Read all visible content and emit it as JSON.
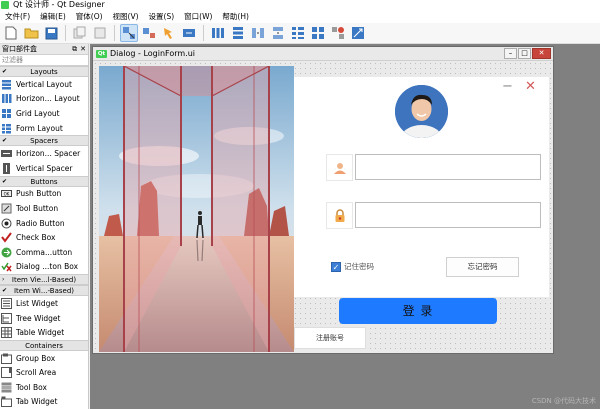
{
  "window": {
    "title": "Qt 设计师 - Qt Designer"
  },
  "menubar": [
    {
      "label": "文件(F)"
    },
    {
      "label": "编辑(E)"
    },
    {
      "label": "窗体(O)"
    },
    {
      "label": "视图(V)"
    },
    {
      "label": "设置(S)"
    },
    {
      "label": "窗口(W)"
    },
    {
      "label": "帮助(H)"
    }
  ],
  "widgetbox": {
    "title": "窗口部件盒",
    "filter_placeholder": "过滤器",
    "sections": [
      {
        "name": "Layouts",
        "items": [
          "Vertical Layout",
          "Horizon... Layout",
          "Grid Layout",
          "Form Layout"
        ]
      },
      {
        "name": "Spacers",
        "items": [
          "Horizon... Spacer",
          "Vertical Spacer"
        ]
      },
      {
        "name": "Buttons",
        "items": [
          "Push Button",
          "Tool Button",
          "Radio Button",
          "Check Box",
          "Comma...utton",
          "Dialog ...ton Box"
        ]
      },
      {
        "name": "Item Vie...l-Based)",
        "items": []
      },
      {
        "name": "Item Wi...-Based)",
        "items": [
          "List Widget",
          "Tree Widget",
          "Table Widget"
        ]
      },
      {
        "name": "Containers",
        "items": [
          "Group Box",
          "Scroll Area",
          "Tool Box",
          "Tab Widget"
        ]
      }
    ]
  },
  "dialog": {
    "title": "Dialog - LoginForm.ui",
    "icon_label": "Qt",
    "form": {
      "remember_label": "记住密码",
      "remember_checked": true,
      "forgot_button": "忘记密码",
      "login_button": "登 录",
      "register_button": "注册账号"
    }
  },
  "watermark": "CSDN @代码大技术",
  "colors": {
    "accent": "#1e7bff",
    "qt_green": "#41cd52",
    "close_red": "#c7453a"
  }
}
